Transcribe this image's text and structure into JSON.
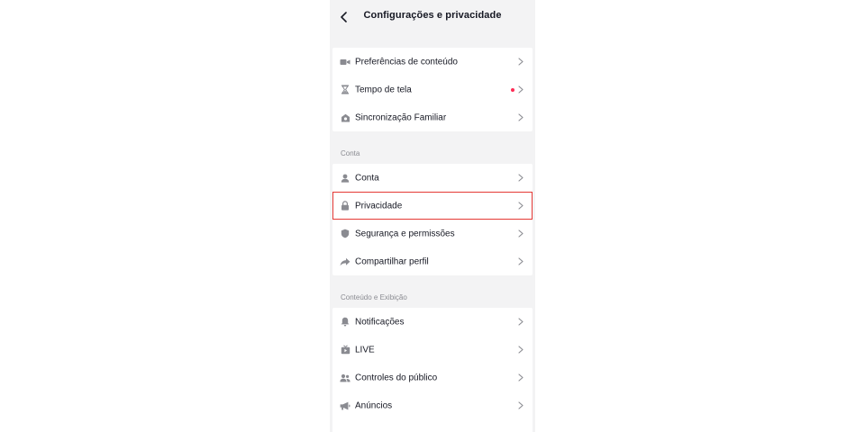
{
  "header": {
    "title": "Configurações e privacidade",
    "back_icon": "chevron-left-icon"
  },
  "groups": [
    {
      "section_label": "",
      "items": [
        {
          "label": "Preferências de conteúdo",
          "icon": "video-camera-icon",
          "notification_dot": false
        },
        {
          "label": "Tempo de tela",
          "icon": "hourglass-icon",
          "notification_dot": true
        },
        {
          "label": "Sincronização Familiar",
          "icon": "house-icon",
          "notification_dot": false
        }
      ]
    },
    {
      "section_label": "Conta",
      "items": [
        {
          "label": "Conta",
          "icon": "person-icon",
          "notification_dot": false
        },
        {
          "label": "Privacidade",
          "icon": "lock-icon",
          "notification_dot": false,
          "highlighted": true
        },
        {
          "label": "Segurança e permissões",
          "icon": "shield-icon",
          "notification_dot": false
        },
        {
          "label": "Compartilhar perfil",
          "icon": "share-arrow-icon",
          "notification_dot": false
        }
      ]
    },
    {
      "section_label": "Conteúdo e Exibição",
      "items": [
        {
          "label": "Notificações",
          "icon": "bell-icon",
          "notification_dot": false
        },
        {
          "label": "LIVE",
          "icon": "live-tv-icon",
          "notification_dot": false
        },
        {
          "label": "Controles do público",
          "icon": "audience-icon",
          "notification_dot": false
        },
        {
          "label": "Anúncios",
          "icon": "megaphone-icon",
          "notification_dot": false
        }
      ]
    }
  ],
  "colors": {
    "background": "#f3f3f4",
    "card": "#ffffff",
    "text": "#161823",
    "muted": "#8a8b91",
    "icon": "#8a8b91",
    "notification_dot": "#fe2c55",
    "highlight_border": "#e53935"
  }
}
